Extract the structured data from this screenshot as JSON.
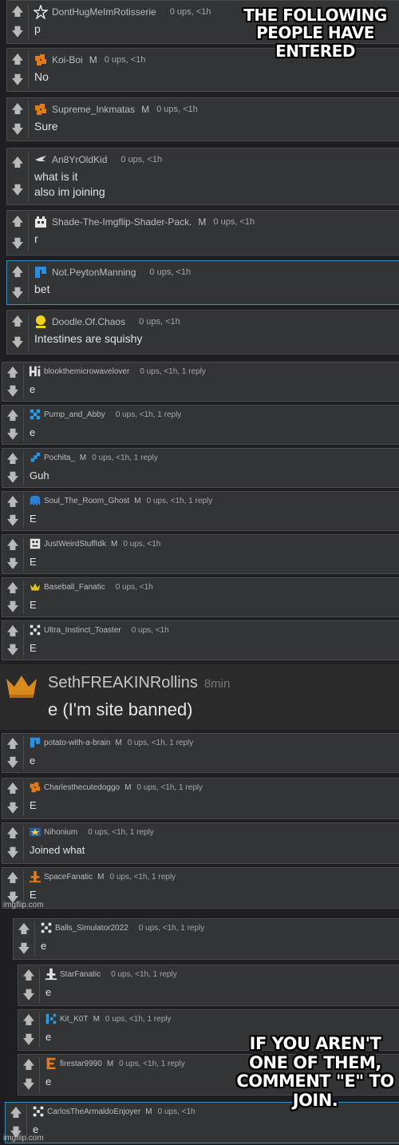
{
  "captions": {
    "top": "THE FOLLOWING PEOPLE HAVE ENTERED",
    "bottom": "IF YOU AREN'T ONE OF THEM, COMMENT \"E\" TO JOIN."
  },
  "watermark": "imgflip.com",
  "vote_icons": {
    "up": "up-arrow-icon",
    "down": "down-arrow-icon"
  },
  "comments": [
    {
      "user": "DontHugMeImRotisserie",
      "badge": "",
      "meta": "0 ups, <1h",
      "text": "p",
      "icon": "star-icon"
    },
    {
      "user": "Koi-Boi",
      "badge": "M",
      "meta": "0 ups, <1h",
      "text": "No",
      "icon": "orange-pixel-icon"
    },
    {
      "user": "Supreme_Inkmatas",
      "badge": "M",
      "meta": "0 ups, <1h",
      "text": "Sure",
      "icon": "orange-pixel-icon"
    },
    {
      "user": "An8YrOldKid",
      "badge": "",
      "meta": "0 ups, <1h",
      "text": "what is it\nalso im joining",
      "icon": "bird-icon"
    },
    {
      "user": "Shade-The-Imgflip-Shader-Pack.",
      "badge": "M",
      "meta": "0 ups, <1h",
      "text": "r",
      "icon": "robot-icon"
    },
    {
      "user": "Not.PeytonManning",
      "badge": "",
      "meta": "0 ups, <1h",
      "text": "bet",
      "icon": "blue-pixel-icon"
    },
    {
      "user": "Doodle.Of.Chaos",
      "badge": "",
      "meta": "0 ups, <1h",
      "text": "Intestines are squishy",
      "icon": "yellow-person-icon"
    },
    {
      "user": "blookthemicrowavelover",
      "badge": "",
      "meta": "0 ups, <1h, 1 reply",
      "text": "e",
      "icon": "hi-icon"
    },
    {
      "user": "Pump_and_Abby",
      "badge": "",
      "meta": "0 ups, <1h, 1 reply",
      "text": "e",
      "icon": "blue-x-icon"
    },
    {
      "user": "Pochita_",
      "badge": "M",
      "meta": "0 ups, <1h, 1 reply",
      "text": "Guh",
      "icon": "blue-diagonal-icon"
    },
    {
      "user": "Soul_The_Room_Ghost",
      "badge": "M",
      "meta": "0 ups, <1h, 1 reply",
      "text": "E",
      "icon": "blue-ghost-icon"
    },
    {
      "user": "JustWeirdStuffIdk",
      "badge": "M",
      "meta": "0 ups, <1h",
      "text": "E",
      "icon": "white-face-icon"
    },
    {
      "user": "Baseball_Fanatic",
      "badge": "",
      "meta": "0 ups, <1h",
      "text": "E",
      "icon": "crown-icon"
    },
    {
      "user": "Ultra_Instinct_Toaster",
      "badge": "",
      "meta": "0 ups, <1h",
      "text": "E",
      "icon": "white-pixel-icon"
    },
    {
      "user": "potato-with-a-brain",
      "badge": "M",
      "meta": "0 ups, <1h, 1 reply",
      "text": "e",
      "icon": "blue-pixel-icon"
    },
    {
      "user": "Charlesthecutedoggo",
      "badge": "M",
      "meta": "0 ups, <1h, 1 reply",
      "text": "E",
      "icon": "orange-pixel-icon"
    },
    {
      "user": "Nihonium",
      "badge": "",
      "meta": "0 ups, <1h, 1 reply",
      "text": "Joined what",
      "icon": "star-flag-icon"
    },
    {
      "user": "SpaceFanatic",
      "badge": "M",
      "meta": "0 ups, <1h, 1 reply",
      "text": "E",
      "icon": "orange-tower-icon"
    },
    {
      "user": "Balls_Simulator2022",
      "badge": "",
      "meta": "0 ups, <1h, 1 reply",
      "text": "e",
      "icon": "white-pixel-icon"
    },
    {
      "user": "StarFanatic",
      "badge": "",
      "meta": "0 ups, <1h, 1 reply",
      "text": "e",
      "icon": "white-tower-icon"
    },
    {
      "user": "Kit_K0T",
      "badge": "M",
      "meta": "0 ups, <1h, 1 reply",
      "text": "e",
      "icon": "blue-k-icon"
    },
    {
      "user": "firestar9990",
      "badge": "M",
      "meta": "0 ups, <1h, 1 reply",
      "text": "e",
      "icon": "orange-e-icon"
    },
    {
      "user": "CarlosTheArmaldoEnjoyer",
      "badge": "M",
      "meta": "0 ups, <1h",
      "text": "e",
      "icon": "white-pixel-icon"
    }
  ],
  "banned": {
    "user": "SethFREAKINRollins",
    "time": "8min",
    "text": "e (I'm site banned)",
    "icon": "orange-crown-icon"
  }
}
